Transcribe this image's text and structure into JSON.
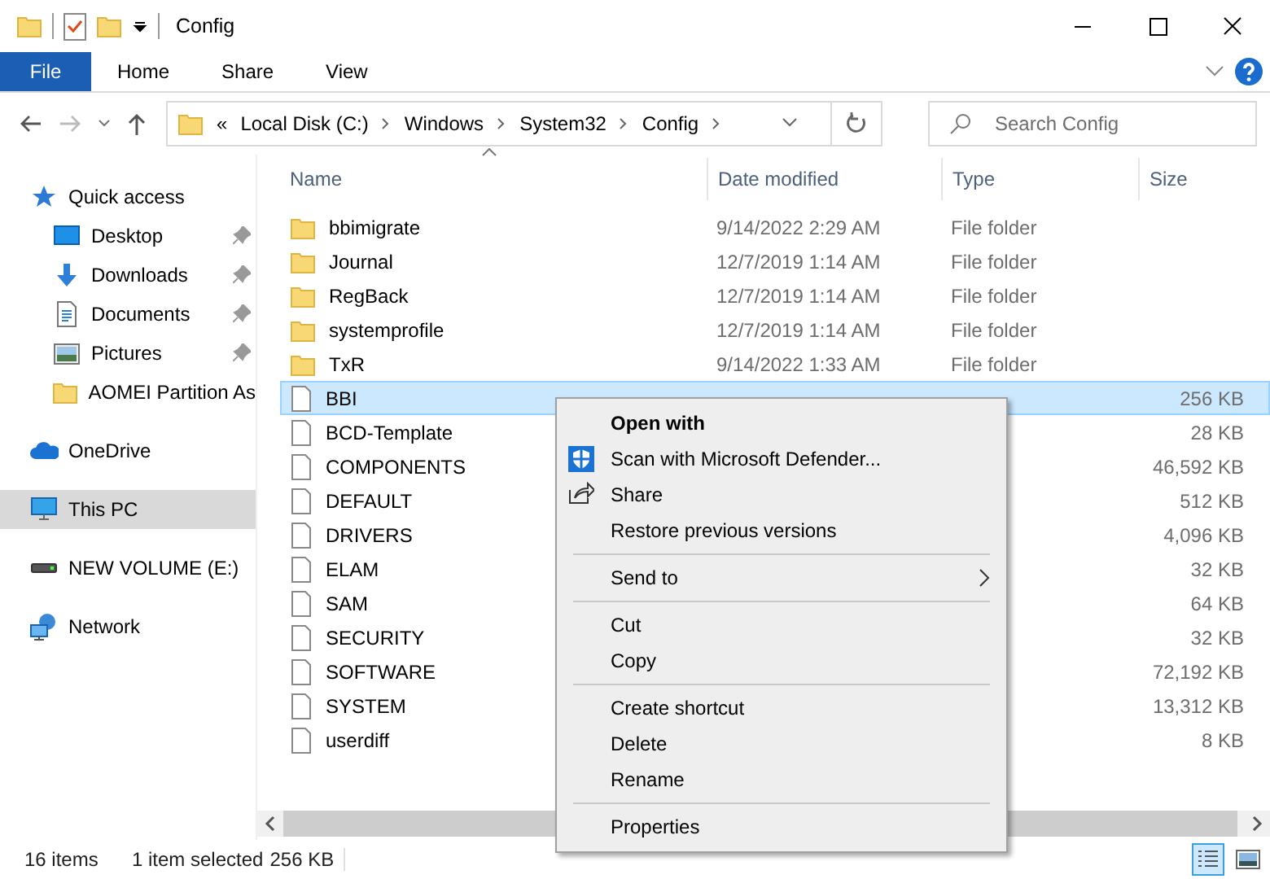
{
  "window": {
    "title": "Config"
  },
  "ribbon": {
    "tabs": [
      {
        "label": "File",
        "kind": "file",
        "selected": false
      },
      {
        "label": "Home",
        "kind": "tab",
        "selected": false
      },
      {
        "label": "Share",
        "kind": "tab",
        "selected": false
      },
      {
        "label": "View",
        "kind": "tab",
        "selected": false
      }
    ]
  },
  "address": {
    "overflow": "«",
    "path": [
      "Local Disk (C:)",
      "Windows",
      "System32",
      "Config"
    ]
  },
  "search": {
    "placeholder": "Search Config"
  },
  "sidebar": {
    "items": [
      {
        "label": "Quick access",
        "kind": "star",
        "selected": false,
        "children": [
          {
            "label": "Desktop",
            "kind": "desktop",
            "pinned": true,
            "selected": false
          },
          {
            "label": "Downloads",
            "kind": "download",
            "pinned": true,
            "selected": false
          },
          {
            "label": "Documents",
            "kind": "document",
            "pinned": true,
            "selected": false
          },
          {
            "label": "Pictures",
            "kind": "pictures",
            "pinned": true,
            "selected": false
          },
          {
            "label": "AOMEI Partition As",
            "kind": "folder",
            "pinned": false,
            "selected": false
          }
        ]
      },
      {
        "label": "OneDrive",
        "kind": "cloud",
        "selected": false
      },
      {
        "label": "This PC",
        "kind": "pc",
        "selected": true
      },
      {
        "label": "NEW VOLUME (E:)",
        "kind": "drive",
        "selected": false
      },
      {
        "label": "Network",
        "kind": "network",
        "selected": false
      }
    ]
  },
  "columns": [
    "Name",
    "Date modified",
    "Type",
    "Size"
  ],
  "files": [
    {
      "name": "bbimigrate",
      "kind": "folder",
      "date": "9/14/2022 2:29 AM",
      "type": "File folder",
      "selected": false
    },
    {
      "name": "Journal",
      "kind": "folder",
      "date": "12/7/2019 1:14 AM",
      "type": "File folder",
      "selected": false
    },
    {
      "name": "RegBack",
      "kind": "folder",
      "date": "12/7/2019 1:14 AM",
      "type": "File folder",
      "selected": false
    },
    {
      "name": "systemprofile",
      "kind": "folder",
      "date": "12/7/2019 1:14 AM",
      "type": "File folder",
      "selected": false
    },
    {
      "name": "TxR",
      "kind": "folder",
      "date": "9/14/2022 1:33 AM",
      "type": "File folder",
      "selected": false
    },
    {
      "name": "BBI",
      "kind": "file",
      "size": "256 KB",
      "selected": true
    },
    {
      "name": "BCD-Template",
      "kind": "file",
      "size": "28 KB",
      "selected": false
    },
    {
      "name": "COMPONENTS",
      "kind": "file",
      "size": "46,592 KB",
      "selected": false
    },
    {
      "name": "DEFAULT",
      "kind": "file",
      "size": "512 KB",
      "selected": false
    },
    {
      "name": "DRIVERS",
      "kind": "file",
      "size": "4,096 KB",
      "selected": false
    },
    {
      "name": "ELAM",
      "kind": "file",
      "size": "32 KB",
      "selected": false
    },
    {
      "name": "SAM",
      "kind": "file",
      "size": "64 KB",
      "selected": false
    },
    {
      "name": "SECURITY",
      "kind": "file",
      "size": "32 KB",
      "selected": false
    },
    {
      "name": "SOFTWARE",
      "kind": "file",
      "size": "72,192 KB",
      "selected": false
    },
    {
      "name": "SYSTEM",
      "kind": "file",
      "size": "13,312 KB",
      "selected": false
    },
    {
      "name": "userdiff",
      "kind": "file",
      "size": "8 KB",
      "selected": false
    }
  ],
  "context_menu": {
    "items": [
      {
        "kind": "item",
        "label": "Open with",
        "bold": true
      },
      {
        "kind": "shield",
        "label": "Scan with Microsoft Defender..."
      },
      {
        "kind": "share",
        "label": "Share"
      },
      {
        "kind": "item",
        "label": "Restore previous versions"
      },
      {
        "kind": "separator"
      },
      {
        "kind": "item",
        "label": "Send to",
        "submenu": true
      },
      {
        "kind": "separator"
      },
      {
        "kind": "item",
        "label": "Cut"
      },
      {
        "kind": "item",
        "label": "Copy"
      },
      {
        "kind": "separator"
      },
      {
        "kind": "item",
        "label": "Create shortcut"
      },
      {
        "kind": "item",
        "label": "Delete"
      },
      {
        "kind": "item",
        "label": "Rename"
      },
      {
        "kind": "separator"
      },
      {
        "kind": "item",
        "label": "Properties"
      }
    ]
  },
  "status_bar": {
    "item_count": "16 items",
    "selection": "1 item selected",
    "selection_size": "256 KB",
    "views": [
      {
        "kind": "details",
        "selected": true
      },
      {
        "kind": "tiles",
        "selected": false
      }
    ]
  }
}
